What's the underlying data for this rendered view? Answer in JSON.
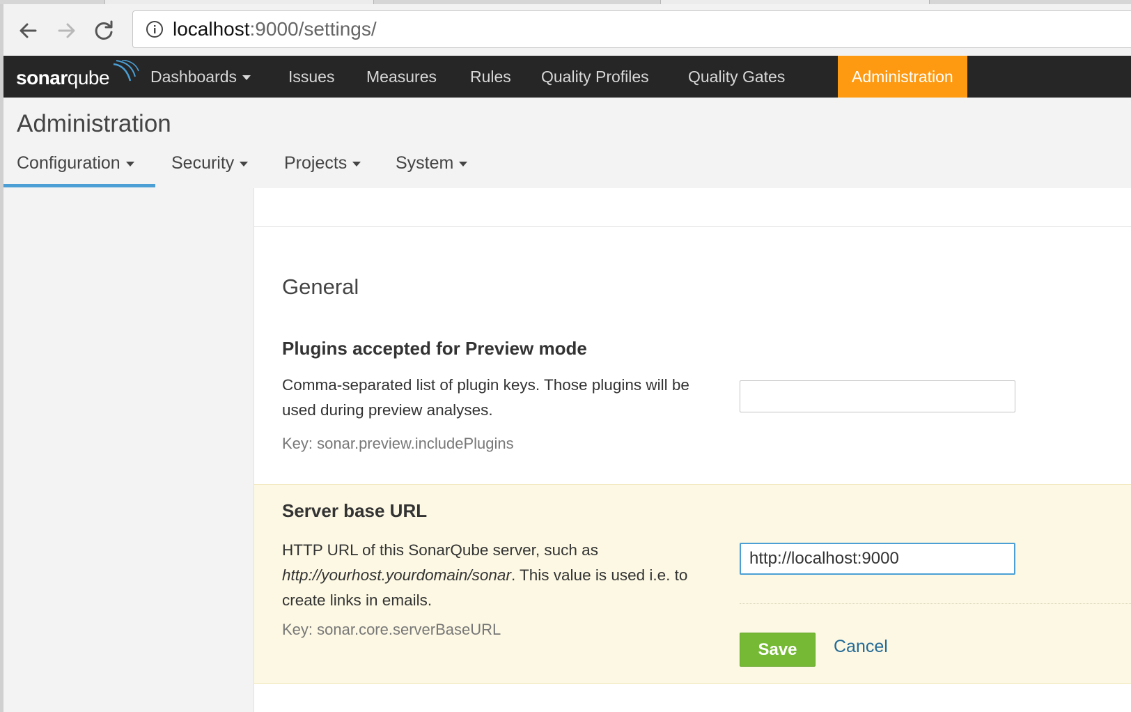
{
  "browser": {
    "url_host": "localhost",
    "url_path": ":9000/settings/"
  },
  "navbar": {
    "logo_bold": "sonar",
    "logo_light": "qube",
    "items": [
      {
        "label": "Dashboards",
        "dropdown": true
      },
      {
        "label": "Issues"
      },
      {
        "label": "Measures"
      },
      {
        "label": "Rules"
      },
      {
        "label": "Quality Profiles"
      },
      {
        "label": "Quality Gates"
      },
      {
        "label": "Administration",
        "active": true
      }
    ],
    "accent_color": "#fd9a11"
  },
  "header": {
    "title": "Administration",
    "tabs": [
      {
        "label": "Configuration",
        "active": true
      },
      {
        "label": "Security"
      },
      {
        "label": "Projects"
      },
      {
        "label": "System"
      }
    ]
  },
  "main": {
    "section_title": "General",
    "settings": [
      {
        "title": "Plugins accepted for Preview mode",
        "description": "Comma-separated list of plugin keys. Those plugins will be used during preview analyses.",
        "key": "Key: sonar.preview.includePlugins",
        "value": ""
      },
      {
        "title": "Server base URL",
        "description_pre": "HTTP URL of this SonarQube server, such as ",
        "description_em": "http://yourhost.yourdomain/sonar",
        "description_post": ". This value is used i.e. to create links in emails.",
        "key": "Key: sonar.core.serverBaseURL",
        "value": "http://localhost:9000"
      }
    ],
    "save_label": "Save",
    "cancel_label": "Cancel"
  }
}
